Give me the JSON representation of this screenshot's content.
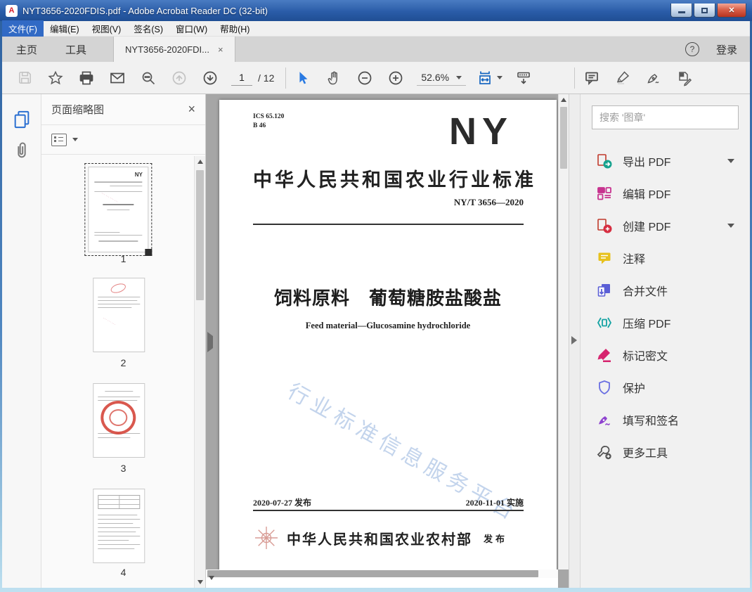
{
  "window": {
    "title": "NYT3656-2020FDIS.pdf - Adobe Acrobat Reader DC (32-bit)",
    "close_glyph": "✕",
    "app_icon_glyph": "A"
  },
  "menubar": {
    "items": [
      {
        "label": "文件(F)",
        "active": true
      },
      {
        "label": "编辑(E)"
      },
      {
        "label": "视图(V)"
      },
      {
        "label": "签名(S)"
      },
      {
        "label": "窗口(W)"
      },
      {
        "label": "帮助(H)"
      }
    ]
  },
  "tabbar": {
    "home": "主页",
    "tools": "工具",
    "document_tab": "NYT3656-2020FDI...",
    "tab_close_glyph": "×",
    "help_glyph": "?",
    "sign_in": "登录"
  },
  "toolbar": {
    "page_current": "1",
    "page_total": "/ 12",
    "zoom_level": "52.6%"
  },
  "thumbnail_panel": {
    "title": "页面缩略图",
    "close_glyph": "×",
    "pages": [
      {
        "num": "1"
      },
      {
        "num": "2"
      },
      {
        "num": "3"
      },
      {
        "num": "4"
      }
    ]
  },
  "document": {
    "ics": "ICS 65.120",
    "class_code": "B 46",
    "logo": "NY",
    "standard_heading": "中华人民共和国农业行业标准",
    "standard_number": "NY/T 3656—2020",
    "title_cn": "饲料原料　葡萄糖胺盐酸盐",
    "title_en": "Feed material—Glucosamine hydrochloride",
    "watermark": "行业标准信息服务平台",
    "issue_date": "2020-07-27 发布",
    "impl_date": "2020-11-01 实施",
    "publisher": "中华人民共和国农业农村部",
    "publish_label": "发布"
  },
  "right_panel": {
    "search_placeholder": "搜索 '图章'",
    "tools": [
      {
        "label": "导出 PDF",
        "chevron": true,
        "color": "#17a28e"
      },
      {
        "label": "编辑 PDF",
        "color": "#c7338f"
      },
      {
        "label": "创建 PDF",
        "chevron": true,
        "color": "#d62e41"
      },
      {
        "label": "注释",
        "color": "#e7c11d"
      },
      {
        "label": "合并文件",
        "color": "#5b5fd6"
      },
      {
        "label": "压缩 PDF",
        "color": "#15a3a3"
      },
      {
        "label": "标记密文",
        "color": "#d6246e"
      },
      {
        "label": "保护",
        "color": "#6a6fe2"
      },
      {
        "label": "填写和签名",
        "color": "#8f44cf"
      },
      {
        "label": "更多工具",
        "color": "#555555"
      }
    ]
  },
  "icons": {
    "toolbar": [
      "save-icon",
      "star-icon",
      "print-icon",
      "email-icon",
      "search-icon",
      "page-up-icon",
      "page-down-icon",
      "select-tool-icon",
      "hand-tool-icon",
      "zoom-out-icon",
      "zoom-in-icon",
      "fit-width-icon",
      "page-display-icon",
      "comment-icon",
      "highlight-icon",
      "fill-sign-icon",
      "stamp-icon"
    ],
    "sidebar": [
      "page-thumbnails-icon",
      "attachments-icon"
    ]
  }
}
